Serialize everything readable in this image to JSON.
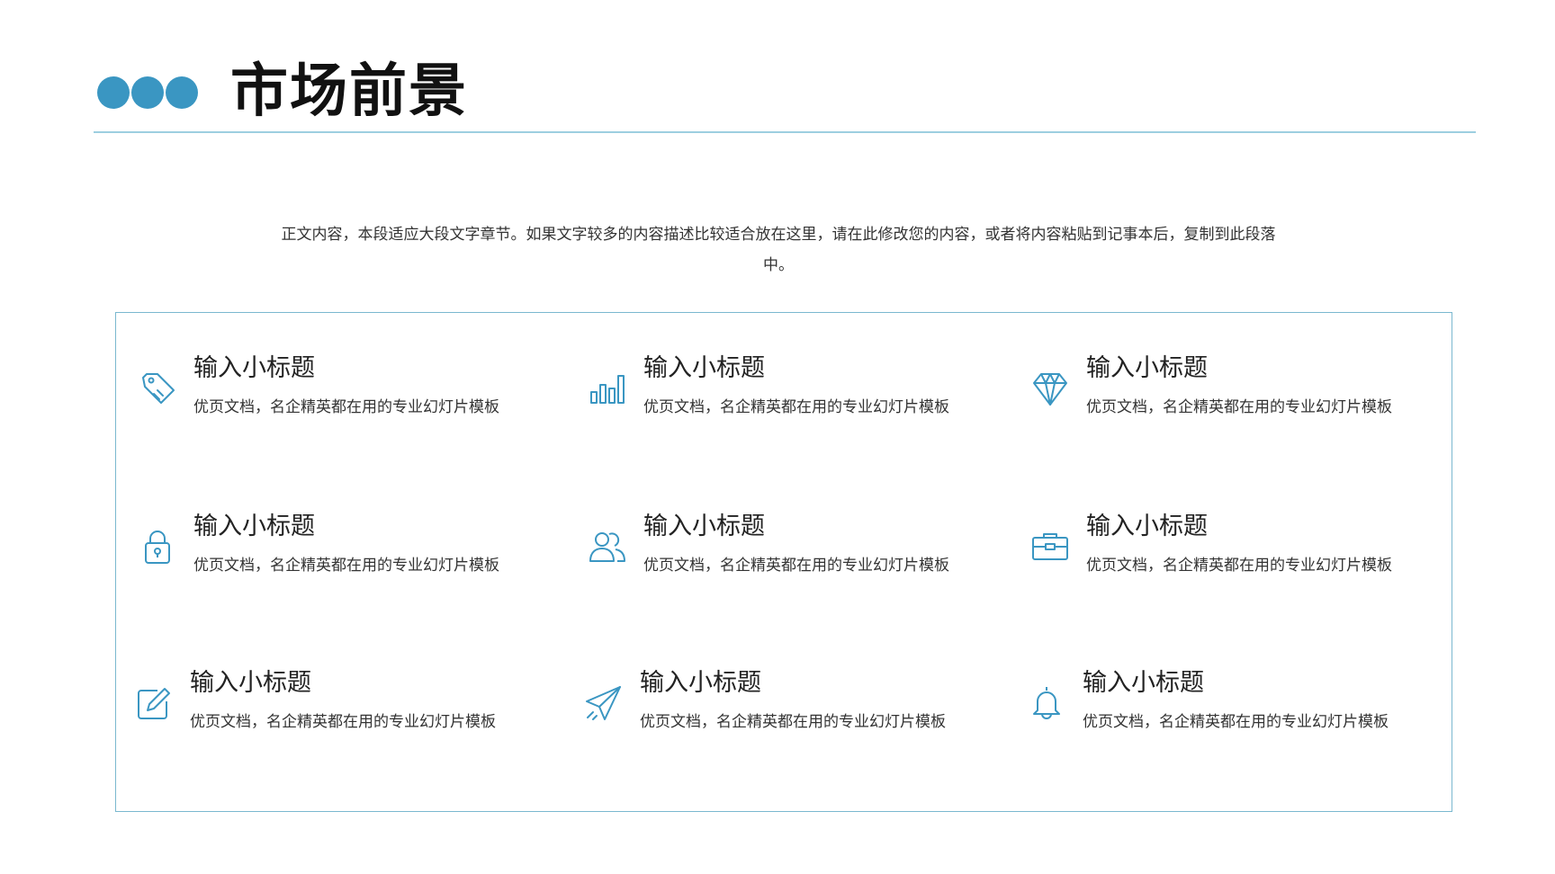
{
  "header": {
    "title": "市场前景",
    "accent_color": "#3a96c2"
  },
  "intro": "正文内容，本段适应大段文字章节。如果文字较多的内容描述比较适合放在这里，请在此修改您的内容，或者将内容粘贴到记事本后，复制到此段落中。",
  "items": [
    {
      "icon": "tag-icon",
      "title": "输入小标题",
      "desc": "优页文档，名企精英都在用的专业幻灯片模板"
    },
    {
      "icon": "bar-chart-icon",
      "title": "输入小标题",
      "desc": "优页文档，名企精英都在用的专业幻灯片模板"
    },
    {
      "icon": "diamond-icon",
      "title": "输入小标题",
      "desc": "优页文档，名企精英都在用的专业幻灯片模板"
    },
    {
      "icon": "lock-icon",
      "title": "输入小标题",
      "desc": "优页文档，名企精英都在用的专业幻灯片模板"
    },
    {
      "icon": "users-icon",
      "title": "输入小标题",
      "desc": "优页文档，名企精英都在用的专业幻灯片模板"
    },
    {
      "icon": "briefcase-icon",
      "title": "输入小标题",
      "desc": "优页文档，名企精英都在用的专业幻灯片模板"
    },
    {
      "icon": "edit-icon",
      "title": "输入小标题",
      "desc": "优页文档，名企精英都在用的专业幻灯片模板"
    },
    {
      "icon": "paper-plane-icon",
      "title": "输入小标题",
      "desc": "优页文档，名企精英都在用的专业幻灯片模板"
    },
    {
      "icon": "bell-icon",
      "title": "输入小标题",
      "desc": "优页文档，名企精英都在用的专业幻灯片模板"
    }
  ]
}
